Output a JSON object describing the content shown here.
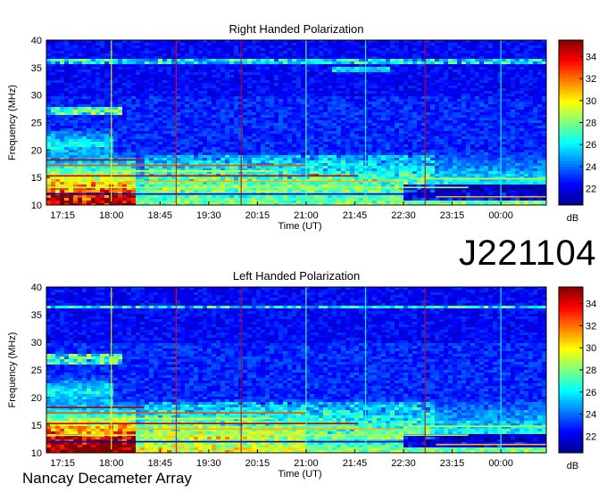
{
  "chart_data": [
    {
      "type": "heatmap",
      "title": "Right Handed Polarization",
      "xlabel": "Time (UT)",
      "ylabel": "Frequency (MHz)",
      "x_ticks": [
        "17:15",
        "18:00",
        "18:45",
        "19:30",
        "20:15",
        "21:00",
        "21:45",
        "22:30",
        "23:15",
        "00:00"
      ],
      "y_ticks": [
        10,
        15,
        20,
        25,
        30,
        35,
        40
      ],
      "ylim": [
        10,
        40
      ],
      "colorbar": {
        "label": "dB",
        "ticks": [
          22,
          24,
          26,
          28,
          30,
          32,
          34
        ],
        "range": [
          20.5,
          35.5
        ]
      },
      "colormap": [
        "#00008f",
        "#0000ff",
        "#0080ff",
        "#00ffff",
        "#80ff80",
        "#ffff00",
        "#ff8000",
        "#ff0000",
        "#800000"
      ],
      "features": {
        "low_band_intense": "10-19 MHz, strongest 17:00-18:30",
        "interference_line_mhz": 36.2,
        "vertical_lines_times": [
          "18:00",
          "19:00",
          "20:00",
          "21:00",
          "21:55",
          "22:50",
          "00:00"
        ]
      }
    },
    {
      "type": "heatmap",
      "title": "Left Handed Polarization",
      "xlabel": "Time (UT)",
      "ylabel": "Frequency (MHz)",
      "x_ticks": [
        "17:15",
        "18:00",
        "18:45",
        "19:30",
        "20:15",
        "21:00",
        "21:45",
        "22:30",
        "23:15",
        "00:00"
      ],
      "y_ticks": [
        10,
        15,
        20,
        25,
        30,
        35,
        40
      ],
      "ylim": [
        10,
        40
      ],
      "colorbar": {
        "label": "dB",
        "ticks": [
          22,
          24,
          26,
          28,
          30,
          32,
          34
        ],
        "range": [
          20.5,
          35.5
        ]
      },
      "colormap": [
        "#00008f",
        "#0000ff",
        "#0080ff",
        "#00ffff",
        "#80ff80",
        "#ffff00",
        "#ff8000",
        "#ff0000",
        "#800000"
      ],
      "features": {
        "low_band_intense": "10-20 MHz, strongest 17:00-21:00",
        "interference_line_mhz": 36.4,
        "vertical_lines_times": [
          "18:00",
          "19:00",
          "20:00",
          "21:00",
          "21:55",
          "22:50",
          "00:00"
        ]
      }
    }
  ],
  "observation_id": "J221104",
  "credit": "Nancay Decameter Array"
}
